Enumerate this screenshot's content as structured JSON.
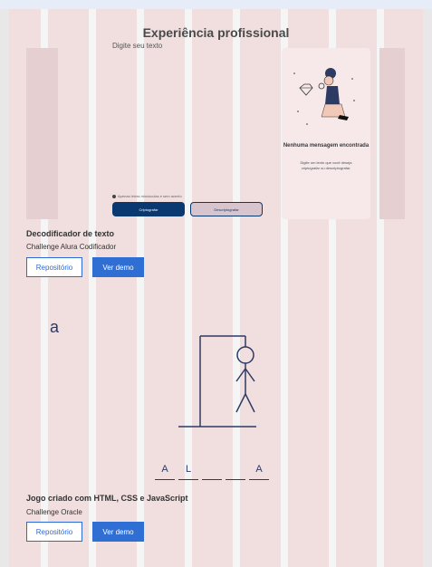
{
  "section": {
    "title": "Experiência profissional"
  },
  "projects": [
    {
      "name": "Decodificador de texto",
      "subtitle": "Challenge Alura Codificador",
      "repo_label": "Repositório",
      "demo_label": "Ver demo",
      "preview": {
        "placeholder": "Digite seu texto",
        "warning": "Apenas letras minúsculas e sem acento",
        "encrypt_label": "Criptografar",
        "decrypt_label": "Descriptografar",
        "empty_title": "Nenhuma mensagem encontrada",
        "empty_text": "Digite um texto que você deseja criptografar ou descriptografar."
      }
    },
    {
      "name": "Jogo criado com HTML, CSS e JavaScript",
      "subtitle": "Challenge Oracle",
      "repo_label": "Repositório",
      "demo_label": "Ver demo",
      "preview": {
        "wrong_letter": "a",
        "word_slots": [
          "A",
          "L",
          "",
          "",
          "A"
        ]
      }
    }
  ],
  "icons": {
    "warning": "info-icon",
    "illustration": "person-with-diamond-illustration"
  },
  "colors": {
    "accent": "#2f6fd3",
    "dark_blue": "#0a3871",
    "hangman": "#2d3a64"
  }
}
